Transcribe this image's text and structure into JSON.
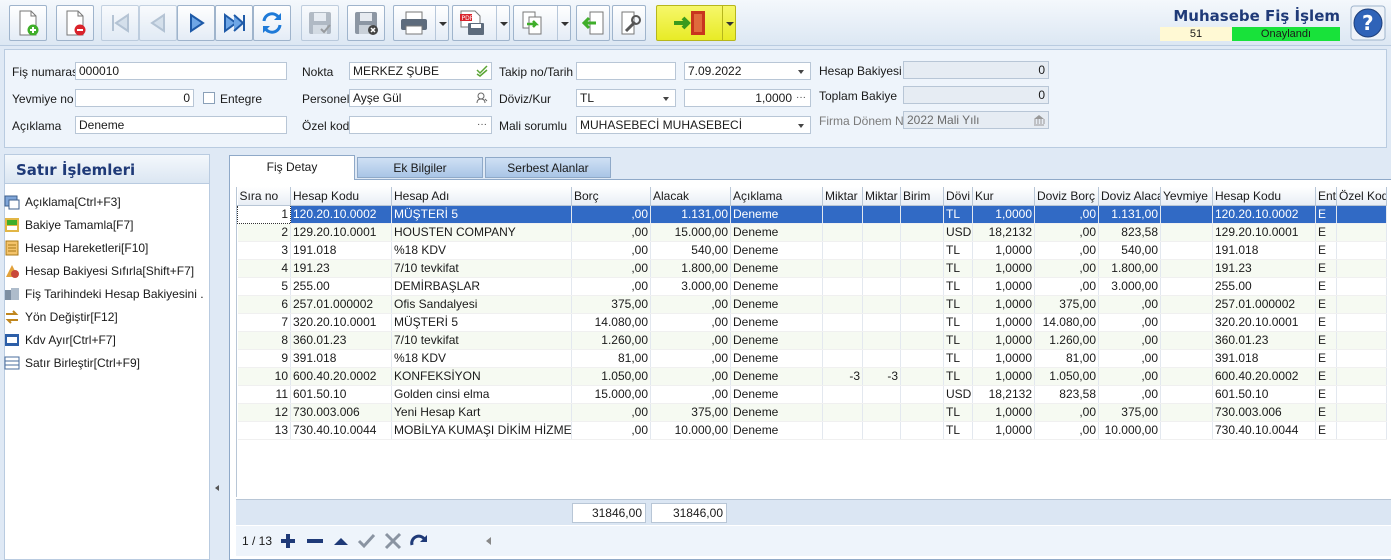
{
  "header": {
    "title": "Muhasebe Fiş İşlem",
    "document_number": "51",
    "status": "Onaylandı"
  },
  "form": {
    "fis_numarasi": {
      "label": "Fiş numarası",
      "value": "000010"
    },
    "yevmiye_no": {
      "label": "Yevmiye no",
      "value": "0"
    },
    "entegre": {
      "label": "Entegre",
      "checked": false
    },
    "aciklama": {
      "label": "Açıklama",
      "value": "Deneme"
    },
    "nokta": {
      "label": "Nokta",
      "value": "MERKEZ ŞUBE"
    },
    "personel": {
      "label": "Personel",
      "value": "Ayşe Gül"
    },
    "ozel_kod": {
      "label": "Özel kod",
      "value": ""
    },
    "takip_no_tarih": {
      "label": "Takip no/Tarih",
      "takip_no": "",
      "tarih": "7.09.2022"
    },
    "doviz_kur": {
      "label": "Döviz/Kur",
      "doviz": "TL",
      "kur": "1,0000"
    },
    "mali_sorumlu": {
      "label": "Mali sorumlu",
      "value": "MUHASEBECİ MUHASEBECİ"
    },
    "hesap_bakiyesi": {
      "label": "Hesap Bakiyesi",
      "value": "0"
    },
    "toplam_bakiye": {
      "label": "Toplam Bakiye",
      "value": "0"
    },
    "firma_donem_no": {
      "label": "Firma Dönem No",
      "value": "2022 Mali Yılı"
    }
  },
  "left_panel": {
    "title": "Satır İşlemleri",
    "items": [
      {
        "label": "Açıklama[Ctrl+F3]",
        "icon": "comment-icon"
      },
      {
        "label": "Bakiye Tamamla[F7]",
        "icon": "balance-icon"
      },
      {
        "label": "Hesap Hareketleri[F10]",
        "icon": "ledger-icon"
      },
      {
        "label": "Hesap Bakiyesi Sıfırla[Shift+F7]",
        "icon": "reset-balance-icon"
      },
      {
        "label": "Fiş Tarihindeki Hesap Bakiyesini ...",
        "icon": "date-balance-icon"
      },
      {
        "label": "Yön Değiştir[F12]",
        "icon": "swap-direction-icon"
      },
      {
        "label": "Kdv Ayır[Ctrl+F7]",
        "icon": "vat-split-icon"
      },
      {
        "label": "Satır Birleştir[Ctrl+F9]",
        "icon": "merge-rows-icon"
      }
    ]
  },
  "tabs": [
    {
      "label": "Fiş Detay",
      "active": true
    },
    {
      "label": "Ek Bilgiler",
      "active": false
    },
    {
      "label": "Serbest Alanlar",
      "active": false
    }
  ],
  "grid": {
    "columns": [
      "Sıra no",
      "Hesap Kodu",
      "Hesap Adı",
      "Borç",
      "Alacak",
      "Açıklama",
      "Miktar",
      "Miktar",
      "Birim",
      "Dövi",
      "Kur",
      "Doviz Borç",
      "Doviz Alacal",
      "Yevmiye S",
      "Hesap Kodu",
      "Ent",
      "Özel Kod"
    ],
    "rows": [
      [
        "1",
        "120.20.10.0002",
        "MÜŞTERİ 5",
        ",00",
        "1.131,00",
        "Deneme",
        "",
        "",
        "",
        "TL",
        "1,0000",
        ",00",
        "1.131,00",
        "",
        "120.20.10.0002",
        "E",
        ""
      ],
      [
        "2",
        "129.20.10.0001",
        "HOUSTEN COMPANY",
        ",00",
        "15.000,00",
        "Deneme",
        "",
        "",
        "",
        "USD",
        "18,2132",
        ",00",
        "823,58",
        "",
        "129.20.10.0001",
        "E",
        ""
      ],
      [
        "3",
        "191.018",
        "%18 KDV",
        ",00",
        "540,00",
        "Deneme",
        "",
        "",
        "",
        "TL",
        "1,0000",
        ",00",
        "540,00",
        "",
        "191.018",
        "E",
        ""
      ],
      [
        "4",
        "191.23",
        "7/10 tevkifat",
        ",00",
        "1.800,00",
        "Deneme",
        "",
        "",
        "",
        "TL",
        "1,0000",
        ",00",
        "1.800,00",
        "",
        "191.23",
        "E",
        ""
      ],
      [
        "5",
        "255.00",
        "DEMİRBAŞLAR",
        ",00",
        "3.000,00",
        "Deneme",
        "",
        "",
        "",
        "TL",
        "1,0000",
        ",00",
        "3.000,00",
        "",
        "255.00",
        "E",
        ""
      ],
      [
        "6",
        "257.01.000002",
        "Ofis Sandalyesi",
        "375,00",
        ",00",
        "Deneme",
        "",
        "",
        "",
        "TL",
        "1,0000",
        "375,00",
        ",00",
        "",
        "257.01.000002",
        "E",
        ""
      ],
      [
        "7",
        "320.20.10.0001",
        "MÜŞTERİ 5",
        "14.080,00",
        ",00",
        "Deneme",
        "",
        "",
        "",
        "TL",
        "1,0000",
        "14.080,00",
        ",00",
        "",
        "320.20.10.0001",
        "E",
        ""
      ],
      [
        "8",
        "360.01.23",
        "7/10 tevkifat",
        "1.260,00",
        ",00",
        "Deneme",
        "",
        "",
        "",
        "TL",
        "1,0000",
        "1.260,00",
        ",00",
        "",
        "360.01.23",
        "E",
        ""
      ],
      [
        "9",
        "391.018",
        "%18 KDV",
        "81,00",
        ",00",
        "Deneme",
        "",
        "",
        "",
        "TL",
        "1,0000",
        "81,00",
        ",00",
        "",
        "391.018",
        "E",
        ""
      ],
      [
        "10",
        "600.40.20.0002",
        "KONFEKSİYON",
        "1.050,00",
        ",00",
        "Deneme",
        "-3",
        "-3",
        "",
        "TL",
        "1,0000",
        "1.050,00",
        ",00",
        "",
        "600.40.20.0002",
        "E",
        ""
      ],
      [
        "11",
        "601.50.10",
        "Golden cinsi elma",
        "15.000,00",
        ",00",
        "Deneme",
        "",
        "",
        "",
        "USD",
        "18,2132",
        "823,58",
        ",00",
        "",
        "601.50.10",
        "E",
        ""
      ],
      [
        "12",
        "730.003.006",
        "Yeni Hesap Kart",
        ",00",
        "375,00",
        "Deneme",
        "",
        "",
        "",
        "TL",
        "1,0000",
        ",00",
        "375,00",
        "",
        "730.003.006",
        "E",
        ""
      ],
      [
        "13",
        "730.40.10.0044",
        "MOBİLYA KUMAŞI DİKİM HİZMETİ",
        ",00",
        "10.000,00",
        "Deneme",
        "",
        "",
        "",
        "TL",
        "1,0000",
        ",00",
        "10.000,00",
        "",
        "730.40.10.0044",
        "E",
        ""
      ]
    ],
    "totals": {
      "borc": "31846,00",
      "alacak": "31846,00"
    },
    "record_position": "1 / 13"
  },
  "colors": {
    "title": "#1f3a78",
    "status_green": "#18e23a",
    "selection": "#316ac5",
    "exit_yellow": "#e8eb26"
  }
}
